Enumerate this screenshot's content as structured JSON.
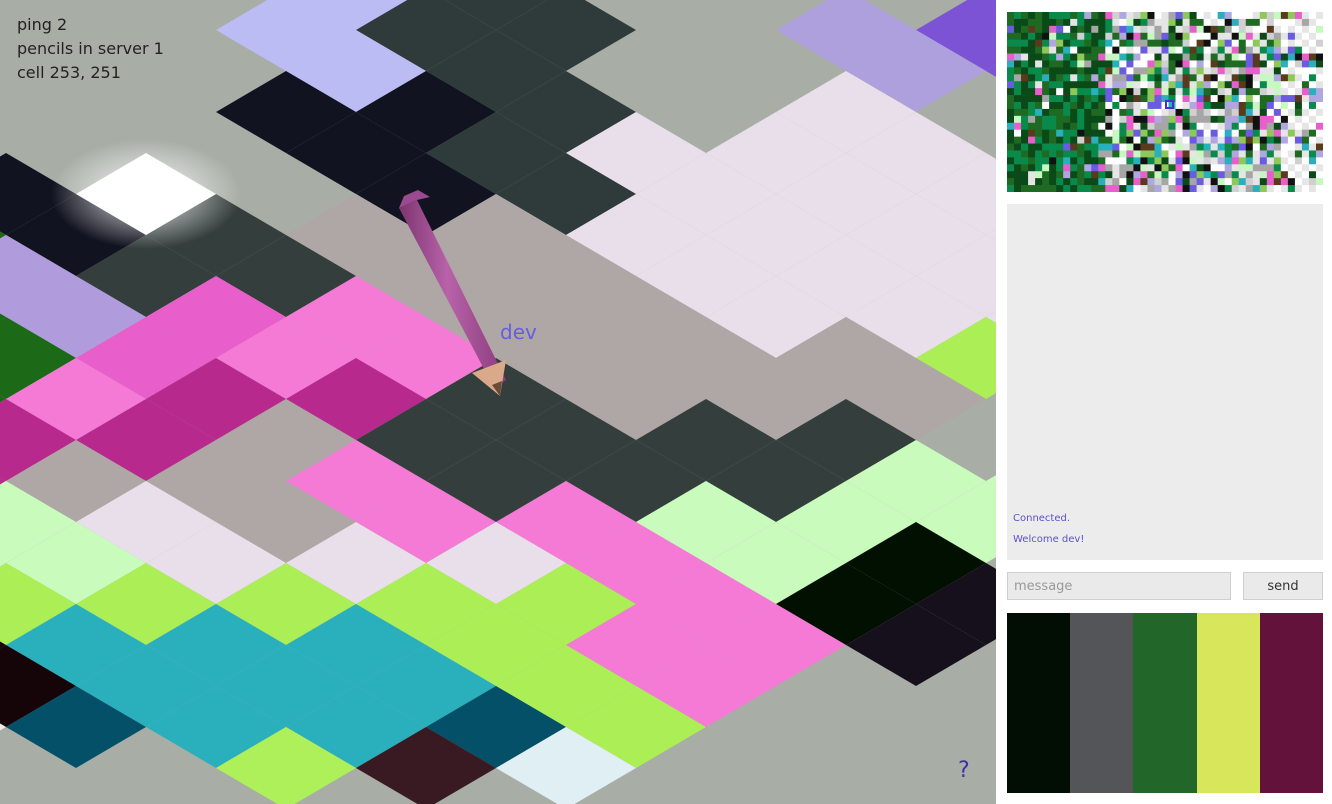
{
  "hud": {
    "ping": "ping 2",
    "pencils": "pencils in server 1",
    "cell": "cell 253, 251"
  },
  "player": {
    "name": "dev",
    "pencil_color": "#a8509a",
    "name_color": "#6a5ce0"
  },
  "help": {
    "label": "?"
  },
  "chat": {
    "messages": [
      "Connected.",
      "Welcome dev!"
    ]
  },
  "message_box": {
    "placeholder": "message",
    "value": ""
  },
  "send": {
    "label": "send"
  },
  "palette": {
    "colors": [
      "#020d04",
      "#535558",
      "#226629",
      "#d8e65c",
      "#63133b"
    ]
  }
}
